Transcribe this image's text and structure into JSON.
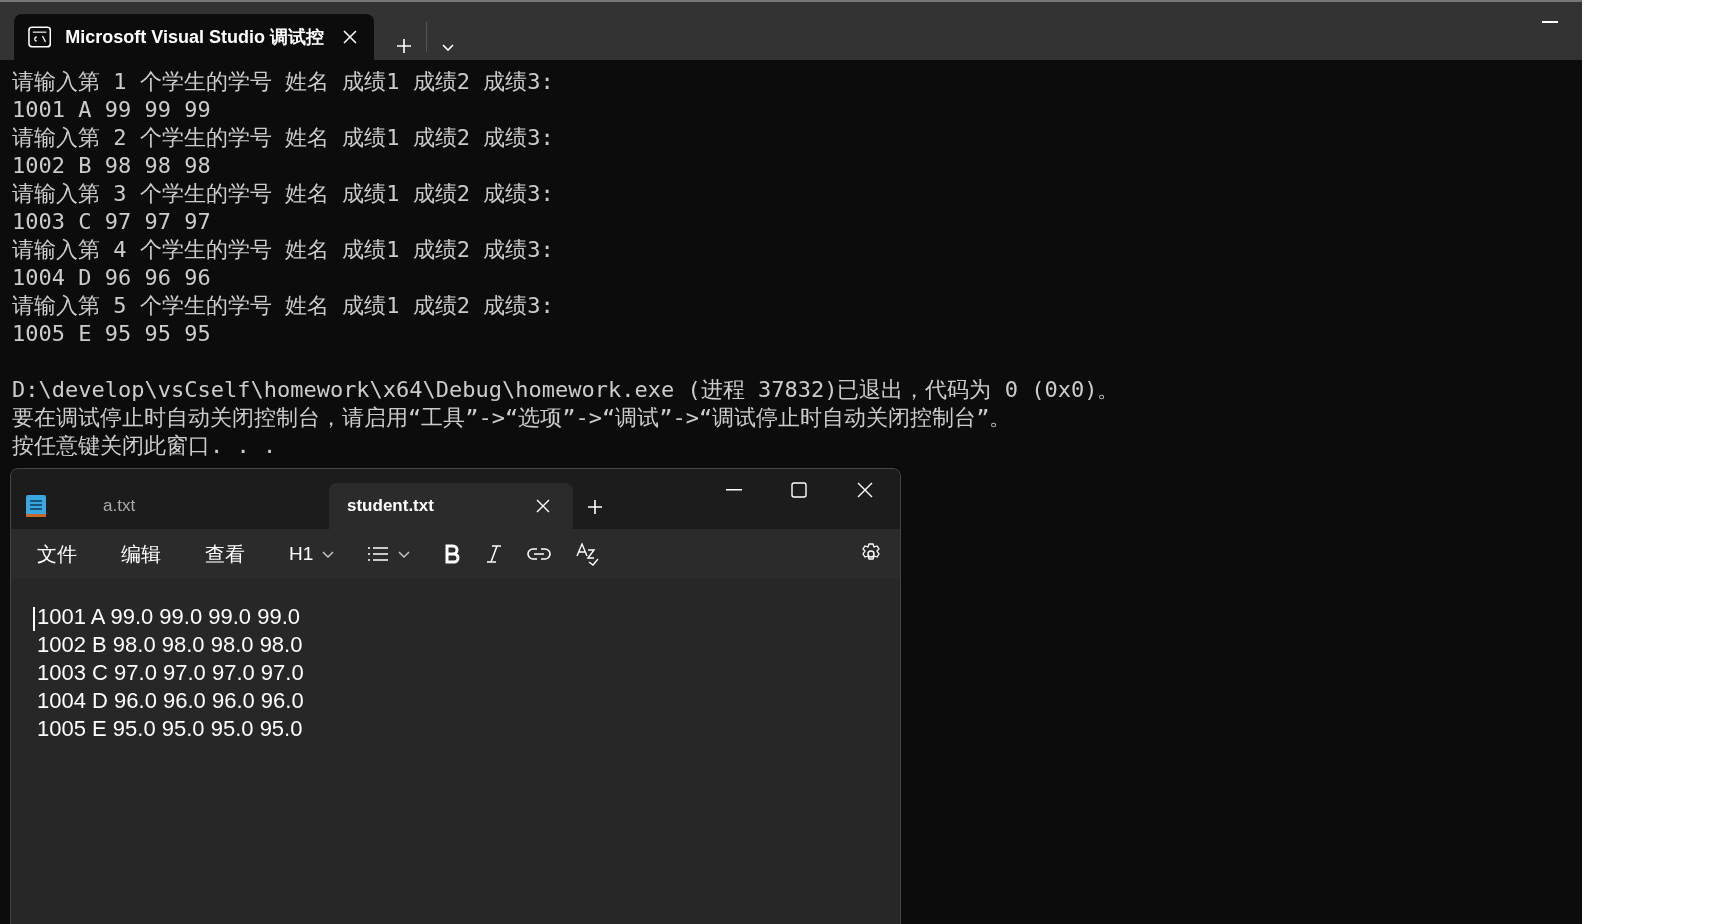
{
  "terminal": {
    "tabs": [
      {
        "title": "Microsoft Visual Studio 调试控",
        "selected": true
      }
    ],
    "input_lines": [
      "请输入第 1 个学生的学号 姓名 成绩1 成绩2 成绩3:",
      "1001 A 99 99 99",
      "请输入第 2 个学生的学号 姓名 成绩1 成绩2 成绩3:",
      "1002 B 98 98 98",
      "请输入第 3 个学生的学号 姓名 成绩1 成绩2 成绩3:",
      "1003 C 97 97 97",
      "请输入第 4 个学生的学号 姓名 成绩1 成绩2 成绩3:",
      "1004 D 96 96 96",
      "请输入第 5 个学生的学号 姓名 成绩1 成绩2 成绩3:",
      "1005 E 95 95 95"
    ],
    "exit_lines": [
      "D:\\develop\\vsCself\\homework\\x64\\Debug\\homework.exe (进程 37832)已退出，代码为 0 (0x0)。",
      "要在调试停止时自动关闭控制台，请启用“工具”->“选项”->“调试”->“调试停止时自动关闭控制台”。",
      "按任意键关闭此窗口. . ."
    ]
  },
  "notepad": {
    "tabs": [
      {
        "title": "a.txt",
        "selected": false
      },
      {
        "title": "student.txt",
        "selected": true
      }
    ],
    "menu": [
      "文件",
      "编辑",
      "查看"
    ],
    "heading_dropdown": "H1",
    "lines": [
      "1001 A 99.0 99.0 99.0 99.0",
      "1002 B 98.0 98.0 98.0 98.0",
      "1003 C 97.0 97.0 97.0 97.0",
      "1004 D 96.0 96.0 96.0 96.0",
      "1005 E 95.0 95.0 95.0 95.0"
    ]
  }
}
